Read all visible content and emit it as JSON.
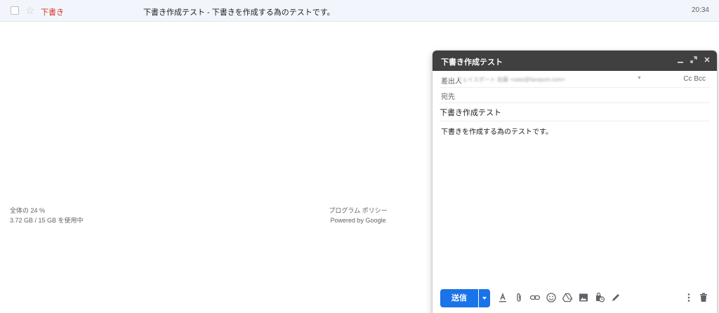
{
  "mail_list": {
    "row": {
      "sender": "下書き",
      "subject_snippet": "下書き作成テスト - 下書きを作成する為のテストです。",
      "time": "20:34"
    }
  },
  "footer": {
    "storage_percent": "全体の 24 %",
    "storage_detail": "3.72 GB / 15 GB を使用中",
    "policy_link": "プログラム ポリシー",
    "powered_by": "Powered by Google"
  },
  "compose": {
    "title": "下書き作成テスト",
    "from_label": "差出人",
    "from_value": "フェイスポート 佐藤 <sato@faceport.com>",
    "cc_bcc_label": "Cc Bcc",
    "to_label": "宛先",
    "subject": "下書き作成テスト",
    "body": "下書きを作成する為のテストです。",
    "send_label": "送信",
    "colors": {
      "header_bg": "#404040",
      "send_btn": "#1a73e8",
      "draft_label": "#d93025"
    },
    "toolbar_icons": [
      "format-text-icon",
      "attach-icon",
      "link-icon",
      "emoji-icon",
      "drive-icon",
      "photo-icon",
      "confidential-icon",
      "signature-icon",
      "more-options-icon",
      "trash-icon"
    ]
  }
}
